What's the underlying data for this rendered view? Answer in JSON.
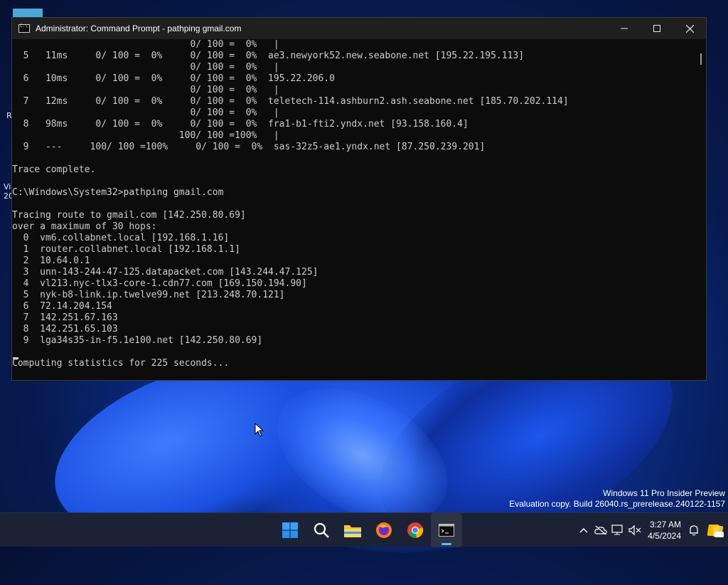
{
  "window": {
    "title": "Administrator: Command Prompt - pathping  gmail.com",
    "controls": {
      "minimize": "minimize",
      "maximize": "maximize",
      "close": "close"
    }
  },
  "console": {
    "lines": [
      "                                0/ 100 =  0%   |",
      "  5   11ms     0/ 100 =  0%     0/ 100 =  0%  ae3.newyork52.new.seabone.net [195.22.195.113]",
      "                                0/ 100 =  0%   |",
      "  6   10ms     0/ 100 =  0%     0/ 100 =  0%  195.22.206.0",
      "                                0/ 100 =  0%   |",
      "  7   12ms     0/ 100 =  0%     0/ 100 =  0%  teletech-114.ashburn2.ash.seabone.net [185.70.202.114]",
      "                                0/ 100 =  0%   |",
      "  8   98ms     0/ 100 =  0%     0/ 100 =  0%  fra1-b1-fti2.yndx.net [93.158.160.4]",
      "                              100/ 100 =100%   |",
      "  9   ---     100/ 100 =100%     0/ 100 =  0%  sas-32z5-ae1.yndx.net [87.250.239.201]",
      "",
      "Trace complete.",
      "",
      "C:\\Windows\\System32>pathping gmail.com",
      "",
      "Tracing route to gmail.com [142.250.80.69]",
      "over a maximum of 30 hops:",
      "  0  vm6.collabnet.local [192.168.1.16]",
      "  1  router.collabnet.local [192.168.1.1]",
      "  2  10.64.0.1",
      "  3  unn-143-244-47-125.datapacket.com [143.244.47.125]",
      "  4  vl213.nyc-tlx3-core-1.cdn77.com [169.150.194.90]",
      "  5  nyk-b8-link.ip.twelve99.net [213.248.70.121]",
      "  6  72.14.204.154",
      "  7  142.251.67.163",
      "  8  142.251.65.103",
      "  9  lga34s35-in-f5.1e100.net [142.250.80.69]",
      "",
      "Computing statistics for 225 seconds..."
    ]
  },
  "desktop": {
    "fragments": [
      "R",
      "Vi",
      "20"
    ],
    "watermark": {
      "line1": "Windows 11 Pro Insider Preview",
      "line2": "Evaluation copy. Build 26040.rs_prerelease.240122-1157"
    }
  },
  "taskbar": {
    "apps": [
      {
        "name": "start",
        "icon": "windows-logo-icon"
      },
      {
        "name": "search",
        "icon": "search-icon"
      },
      {
        "name": "file-explorer",
        "icon": "folder-icon"
      },
      {
        "name": "firefox",
        "icon": "firefox-icon"
      },
      {
        "name": "chrome",
        "icon": "chrome-icon"
      },
      {
        "name": "terminal",
        "icon": "terminal-icon",
        "active": true
      }
    ],
    "clock": {
      "time": "3:27 AM",
      "date": "4/5/2024"
    }
  },
  "colors": {
    "console_bg": "#0c0c0c",
    "console_fg": "#cccccc",
    "accent": "#4cc2ff",
    "taskbar_bg": "#1c2235"
  }
}
